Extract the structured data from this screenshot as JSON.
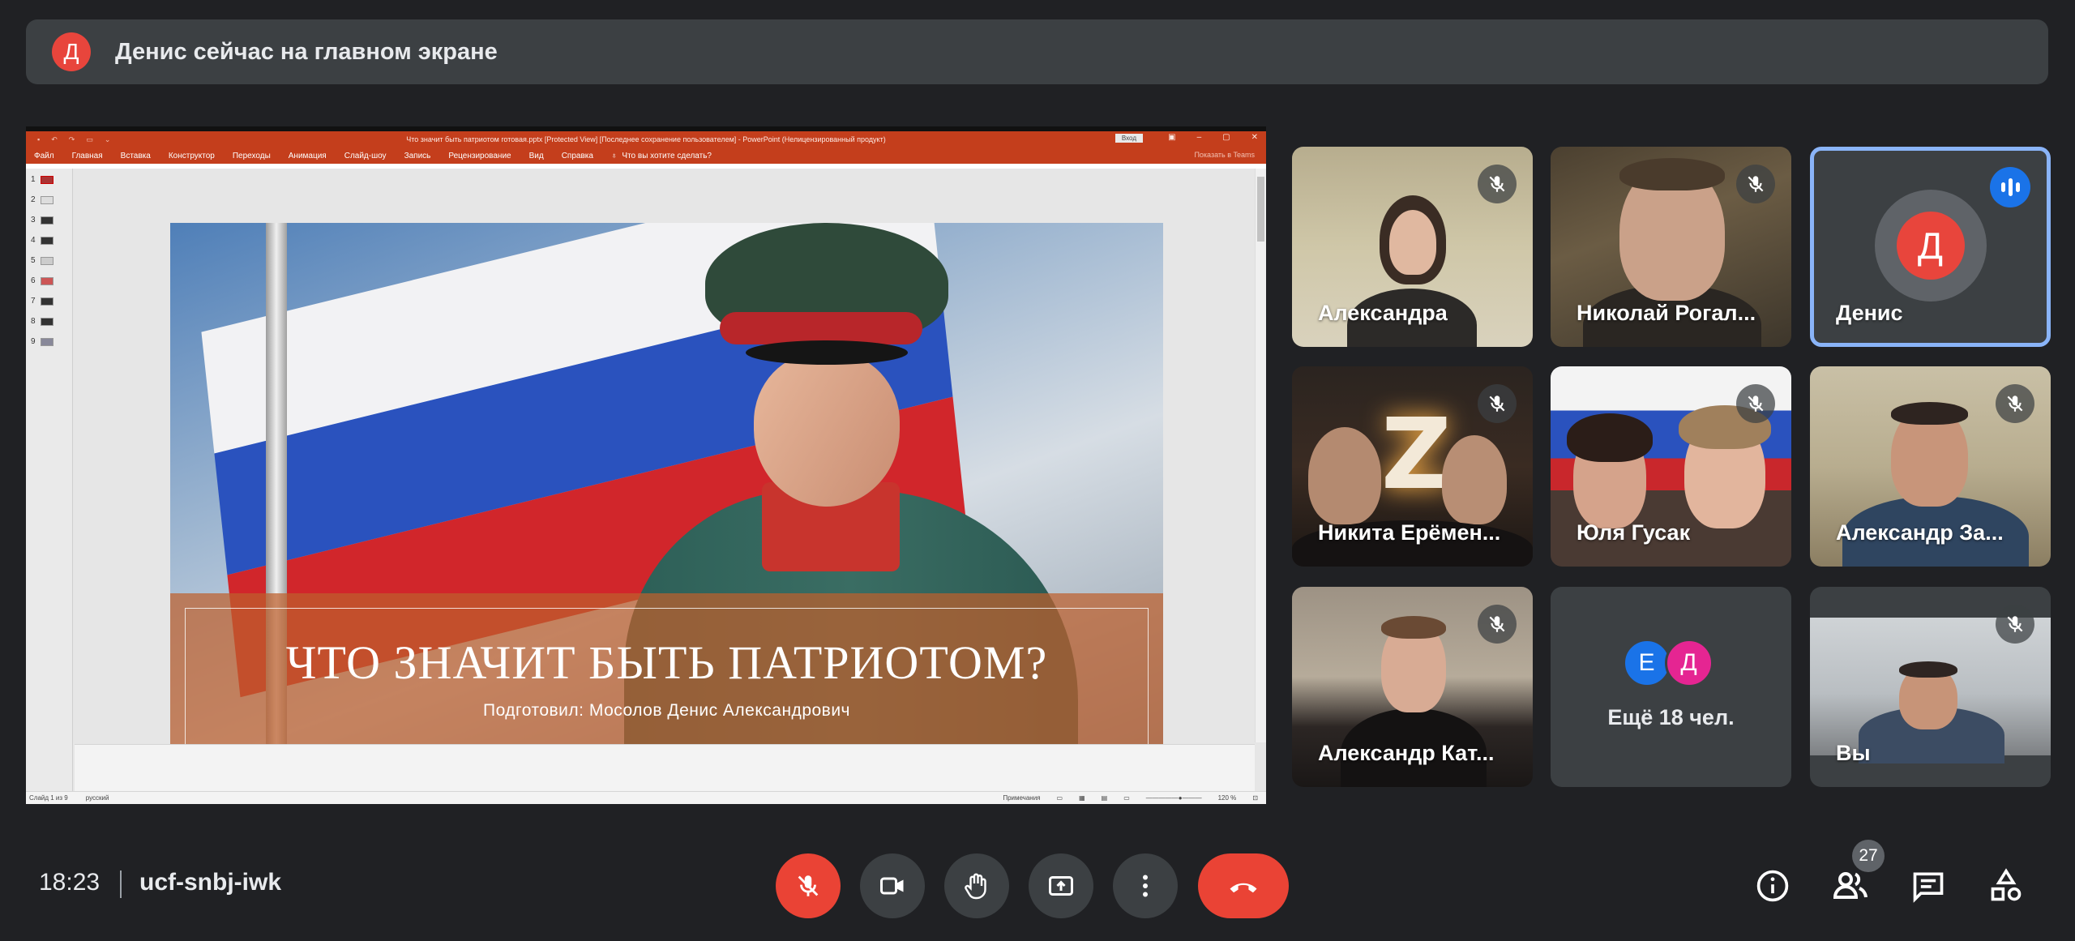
{
  "banner": {
    "avatar_letter": "Д",
    "text": "Денис сейчас на главном экране"
  },
  "powerpoint": {
    "title": "Что значит быть патриотом готовая.pptx [Protected View] [Последнее сохранение пользователем] - PowerPoint (Нелицензированный продукт)",
    "signin_label": "Вход",
    "ribbon_tabs": [
      "Файл",
      "Главная",
      "Вставка",
      "Конструктор",
      "Переходы",
      "Анимация",
      "Слайд-шоу",
      "Запись",
      "Рецензирование",
      "Вид",
      "Справка"
    ],
    "tell_me": "Что вы хотите сделать?",
    "share_label": "Показать в Teams",
    "thumbnail_numbers": [
      "1",
      "2",
      "3",
      "4",
      "5",
      "6",
      "7",
      "8",
      "9"
    ],
    "status_slide": "Слайд 1 из 9",
    "status_language": "русский",
    "status_notes": "Примечания",
    "status_zoom": "120 %"
  },
  "slide": {
    "title": "ЧТО ЗНАЧИТ БЫТЬ ПАТРИОТОМ?",
    "subtitle": "Подготовил: Мосолов Денис Александрович"
  },
  "participants": [
    {
      "name": "Александра",
      "muted": true
    },
    {
      "name": "Николай Рогал...",
      "muted": true
    },
    {
      "name": "Денис",
      "speaking": true,
      "avatar_letter": "Д"
    },
    {
      "name": "Никита Ерёмен...",
      "muted": true
    },
    {
      "name": "Юля Гусак",
      "muted": true
    },
    {
      "name": "Александр За...",
      "muted": true
    },
    {
      "name": "Александр Кат...",
      "muted": true
    },
    {
      "more_label": "Ещё 18 чел.",
      "avatar_letters": [
        "Е",
        "Д"
      ]
    },
    {
      "name": "Вы",
      "muted": true
    }
  ],
  "bottom_bar": {
    "time": "18:23",
    "meeting_code": "ucf-snbj-iwk",
    "participants_count": "27"
  },
  "colors": {
    "background": "#202124",
    "surface": "#3c4043",
    "red": "#ea4335",
    "accent_blue": "#1a73e8",
    "highlight_blue": "#8ab4f8",
    "ppt_orange": "#c43e1c"
  },
  "icons": {
    "mic": "mic-off-icon",
    "camera": "camera-icon",
    "hand": "raise-hand-icon",
    "present": "present-screen-icon",
    "more": "more-vert-icon",
    "hangup": "call-end-icon",
    "info": "info-icon",
    "people": "people-icon",
    "chat": "chat-icon",
    "activities": "activities-icon"
  }
}
